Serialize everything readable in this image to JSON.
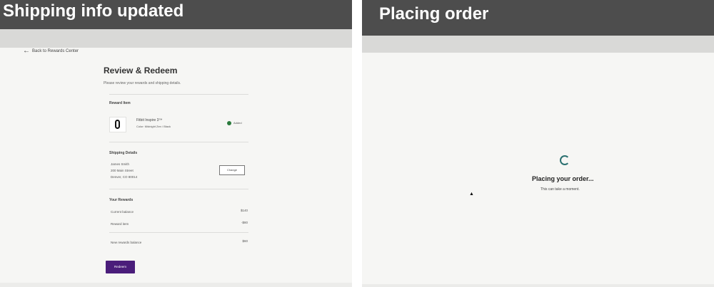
{
  "left_panel": {
    "caption": "Shipping info updated",
    "back_link": "Back to Rewards Center",
    "title": "Review & Redeem",
    "subtitle": "Please review your rewards and shipping details.",
    "reward_item": {
      "heading": "Reward Item",
      "name": "Fitbit Inspire 3™",
      "color": "Color: Midnight Zen / Black",
      "status": "Added"
    },
    "shipping": {
      "heading": "Shipping Details",
      "name": "James Smith",
      "street": "200 Main Street",
      "city": "Denver, CO 80014",
      "change_label": "Change"
    },
    "rewards": {
      "heading": "Your Rewards",
      "current_balance_label": "Current balance",
      "current_balance_value": "$140",
      "reward_item_label": "Reward item",
      "reward_item_value": "-$80",
      "new_balance_label": "New rewards balance",
      "new_balance_value": "$60"
    },
    "redeem_label": "Redeem"
  },
  "right_panel": {
    "caption": "Placing order",
    "status_title": "Placing your order...",
    "status_sub": "This can take a moment."
  },
  "icons": {
    "back": "arrow-left-icon",
    "added": "check-circle-icon",
    "spinner": "loading-spinner-icon",
    "cursor": "mouse-cursor-icon"
  },
  "colors": {
    "caption_bar": "#4d4d4d",
    "redeem_button": "#4a1d7a",
    "added_check": "#2a7a3c",
    "spinner": "#2a7070"
  }
}
